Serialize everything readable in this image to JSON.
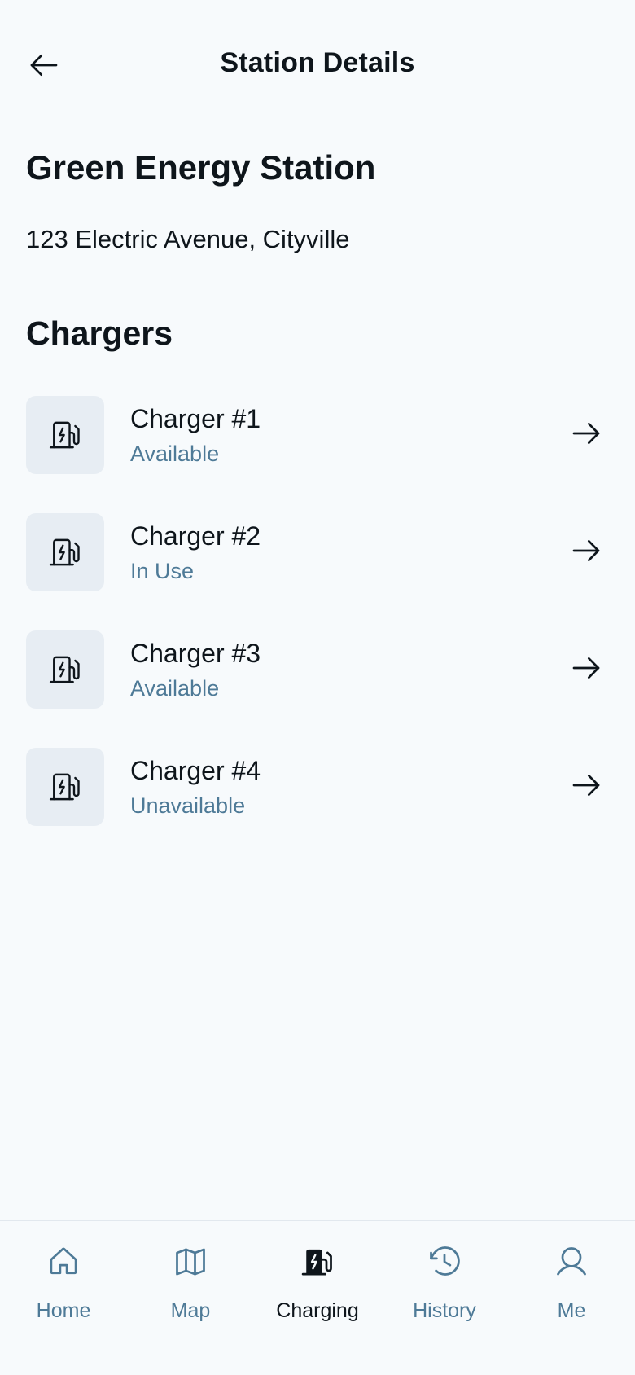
{
  "header": {
    "title": "Station Details"
  },
  "station": {
    "name": "Green Energy Station",
    "address": "123 Electric Avenue, Cityville"
  },
  "chargers_section": {
    "title": "Chargers",
    "items": [
      {
        "name": "Charger #1",
        "status": "Available"
      },
      {
        "name": "Charger #2",
        "status": "In Use"
      },
      {
        "name": "Charger #3",
        "status": "Available"
      },
      {
        "name": "Charger #4",
        "status": "Unavailable"
      }
    ]
  },
  "nav": {
    "items": [
      {
        "label": "Home",
        "icon": "home-icon"
      },
      {
        "label": "Map",
        "icon": "map-icon"
      },
      {
        "label": "Charging",
        "icon": "charging-station-icon",
        "active": true
      },
      {
        "label": "History",
        "icon": "history-icon"
      },
      {
        "label": "Me",
        "icon": "user-icon"
      }
    ]
  },
  "colors": {
    "background": "#f7fafc",
    "text_primary": "#0e151b",
    "text_secondary": "#4e7a97",
    "icon_tile": "#e7edf3"
  }
}
